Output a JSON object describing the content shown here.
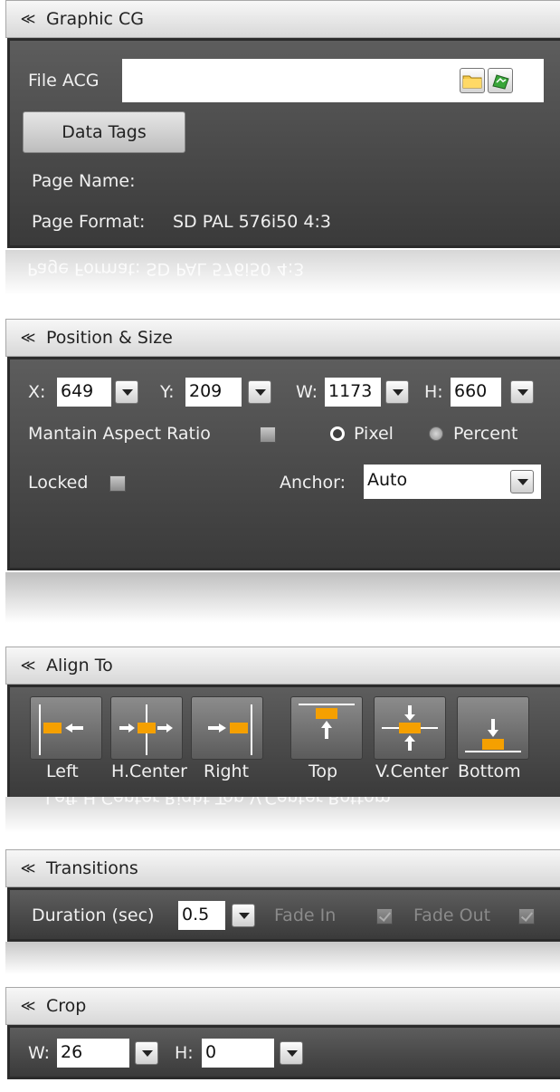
{
  "graphic_cg": {
    "title": "Graphic CG",
    "file_label": "File ACG",
    "file_value": "",
    "data_tags_label": "Data Tags",
    "page_name_label": "Page Name:",
    "page_name_value": "",
    "page_format_label": "Page Format:",
    "page_format_value": "SD PAL 576i50 4:3",
    "reflection_text": "Page Format:  SD PAL 576i50 4:3"
  },
  "position_size": {
    "title": "Position & Size",
    "x_label": "X:",
    "x_value": "649",
    "y_label": "Y:",
    "y_value": "209",
    "w_label": "W:",
    "w_value": "1173",
    "h_label": "H:",
    "h_value": "660",
    "aspect_label": "Mantain Aspect Ratio",
    "aspect_checked": false,
    "pixel_label": "Pixel",
    "percent_label": "Percent",
    "unit_selected": "Pixel",
    "locked_label": "Locked",
    "locked_checked": false,
    "anchor_label": "Anchor:",
    "anchor_value": "Auto"
  },
  "align_to": {
    "title": "Align To",
    "buttons": [
      {
        "label": "Left",
        "icon": "align-left-icon"
      },
      {
        "label": "H.Center",
        "icon": "align-hcenter-icon"
      },
      {
        "label": "Right",
        "icon": "align-right-icon"
      },
      {
        "label": "Top",
        "icon": "align-top-icon"
      },
      {
        "label": "V.Center",
        "icon": "align-vcenter-icon"
      },
      {
        "label": "Bottom",
        "icon": "align-bottom-icon"
      }
    ],
    "reflection_text": "Left  H.Center  Right  Top  V.Center Bottom"
  },
  "transitions": {
    "title": "Transitions",
    "duration_label": "Duration (sec)",
    "duration_value": "0.5",
    "fade_in_label": "Fade In",
    "fade_in_checked": true,
    "fade_out_label": "Fade Out",
    "fade_out_checked": true
  },
  "crop": {
    "title": "Crop",
    "w_label": "W:",
    "w_value": "26",
    "h_label": "H:",
    "h_value": "0"
  },
  "colors": {
    "panel_bg": "#4a4a4a",
    "header_bg": "#e4e4e4",
    "accent_orange": "#f5a000",
    "text_light": "#f0f0f0",
    "text_disabled": "#8a8a8a"
  }
}
